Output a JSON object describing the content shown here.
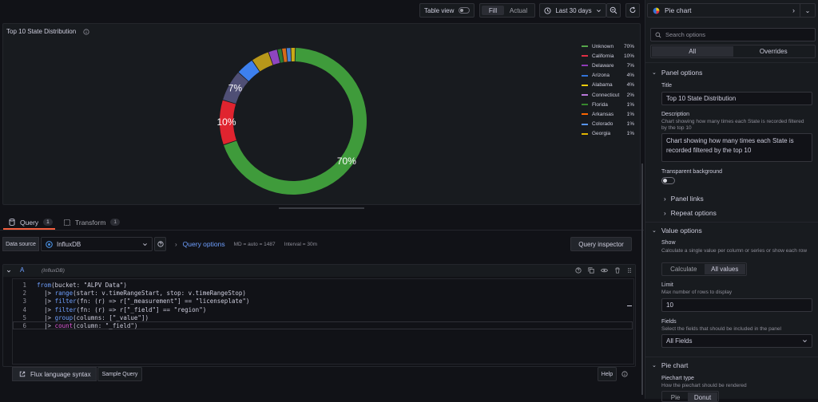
{
  "topbar": {
    "table_view": "Table view",
    "fill": "Fill",
    "actual": "Actual",
    "time_range": "Last 30 days",
    "viz_type": "Pie chart"
  },
  "panel": {
    "title": "Top 10 State Distribution",
    "slice_labels": [
      "70%",
      "10%",
      "7%"
    ]
  },
  "chart_data": {
    "type": "pie",
    "donut": true,
    "categories": [
      "Unknown",
      "California",
      "Delaware",
      "Arizona",
      "Alabama",
      "Connecticut",
      "Florida",
      "Arkansas",
      "Colorado",
      "Georgia"
    ],
    "values": [
      70,
      10,
      7,
      4,
      4,
      2,
      1,
      1,
      1,
      1
    ],
    "value_labels": [
      "70%",
      "10%",
      "7%",
      "4%",
      "4%",
      "2%",
      "1%",
      "1%",
      "1%",
      "1%"
    ],
    "colors": [
      "#56a64b",
      "#e02f44",
      "#8f3bb8",
      "#3274d9",
      "#f2cc0c",
      "#b877d9",
      "#37872d",
      "#fa6400",
      "#5794f2",
      "#e0b400"
    ],
    "slice_colors": [
      "#3f9b3b",
      "#e0242f",
      "#4f4f75",
      "#3d80ee",
      "#b8971a",
      "#8e45c0",
      "#2d7a32",
      "#d46b1a",
      "#4a7fd0",
      "#c9a917"
    ],
    "legend_placement": "right"
  },
  "tabs": {
    "query": "Query",
    "query_count": "1",
    "transform": "Transform",
    "transform_count": "1"
  },
  "query_bar": {
    "data_source_label": "Data source",
    "data_source": "InfluxDB",
    "query_options": "Query options",
    "md": "MD = auto = 1487",
    "interval": "Interval = 30m",
    "query_inspector": "Query inspector"
  },
  "query": {
    "ref": "A",
    "datasource": "(InfluxDB)",
    "line_numbers": [
      "1",
      "2",
      "3",
      "4",
      "5",
      "6"
    ],
    "lines": [
      "from(bucket: \"ALPV Data\")",
      "  |> range(start: v.timeRangeStart, stop: v.timeRangeStop)",
      "  |> filter(fn: (r) => r[\"_measurement\"] == \"licenseplate\")",
      "  |> filter(fn: (r) => r[\"_field\"] == \"region\")",
      "  |> group(columns: [\"_value\"])",
      "  |> count(column: \"_field\")"
    ]
  },
  "footer": {
    "flux_syntax": "Flux language syntax",
    "sample_query": "Sample Query",
    "help": "Help"
  },
  "options": {
    "search_placeholder": "Search options",
    "tab_all": "All",
    "tab_overrides": "Overrides",
    "panel_options": "Panel options",
    "title_label": "Title",
    "title_value": "Top 10 State Distribution",
    "description_label": "Description",
    "description_help": "Chart showing how many times each State is recorded filtered by the top 10",
    "description_value": "Chart showing how many times each State is recorded filtered by the top 10",
    "transparent_label": "Transparent background",
    "panel_links": "Panel links",
    "repeat_options": "Repeat options",
    "value_options": "Value options",
    "show_label": "Show",
    "show_help": "Calculate a single value per column or series or show each row",
    "calculate": "Calculate",
    "all_values": "All values",
    "limit_label": "Limit",
    "limit_help": "Max number of rows to display",
    "limit_value": "10",
    "fields_label": "Fields",
    "fields_help": "Select the fields that should be included in the panel",
    "fields_value": "All Fields",
    "pie_chart": "Pie chart",
    "piechart_type_label": "Piechart type",
    "piechart_type_help": "How the piechart should be rendered",
    "pie": "Pie",
    "donut": "Donut"
  }
}
